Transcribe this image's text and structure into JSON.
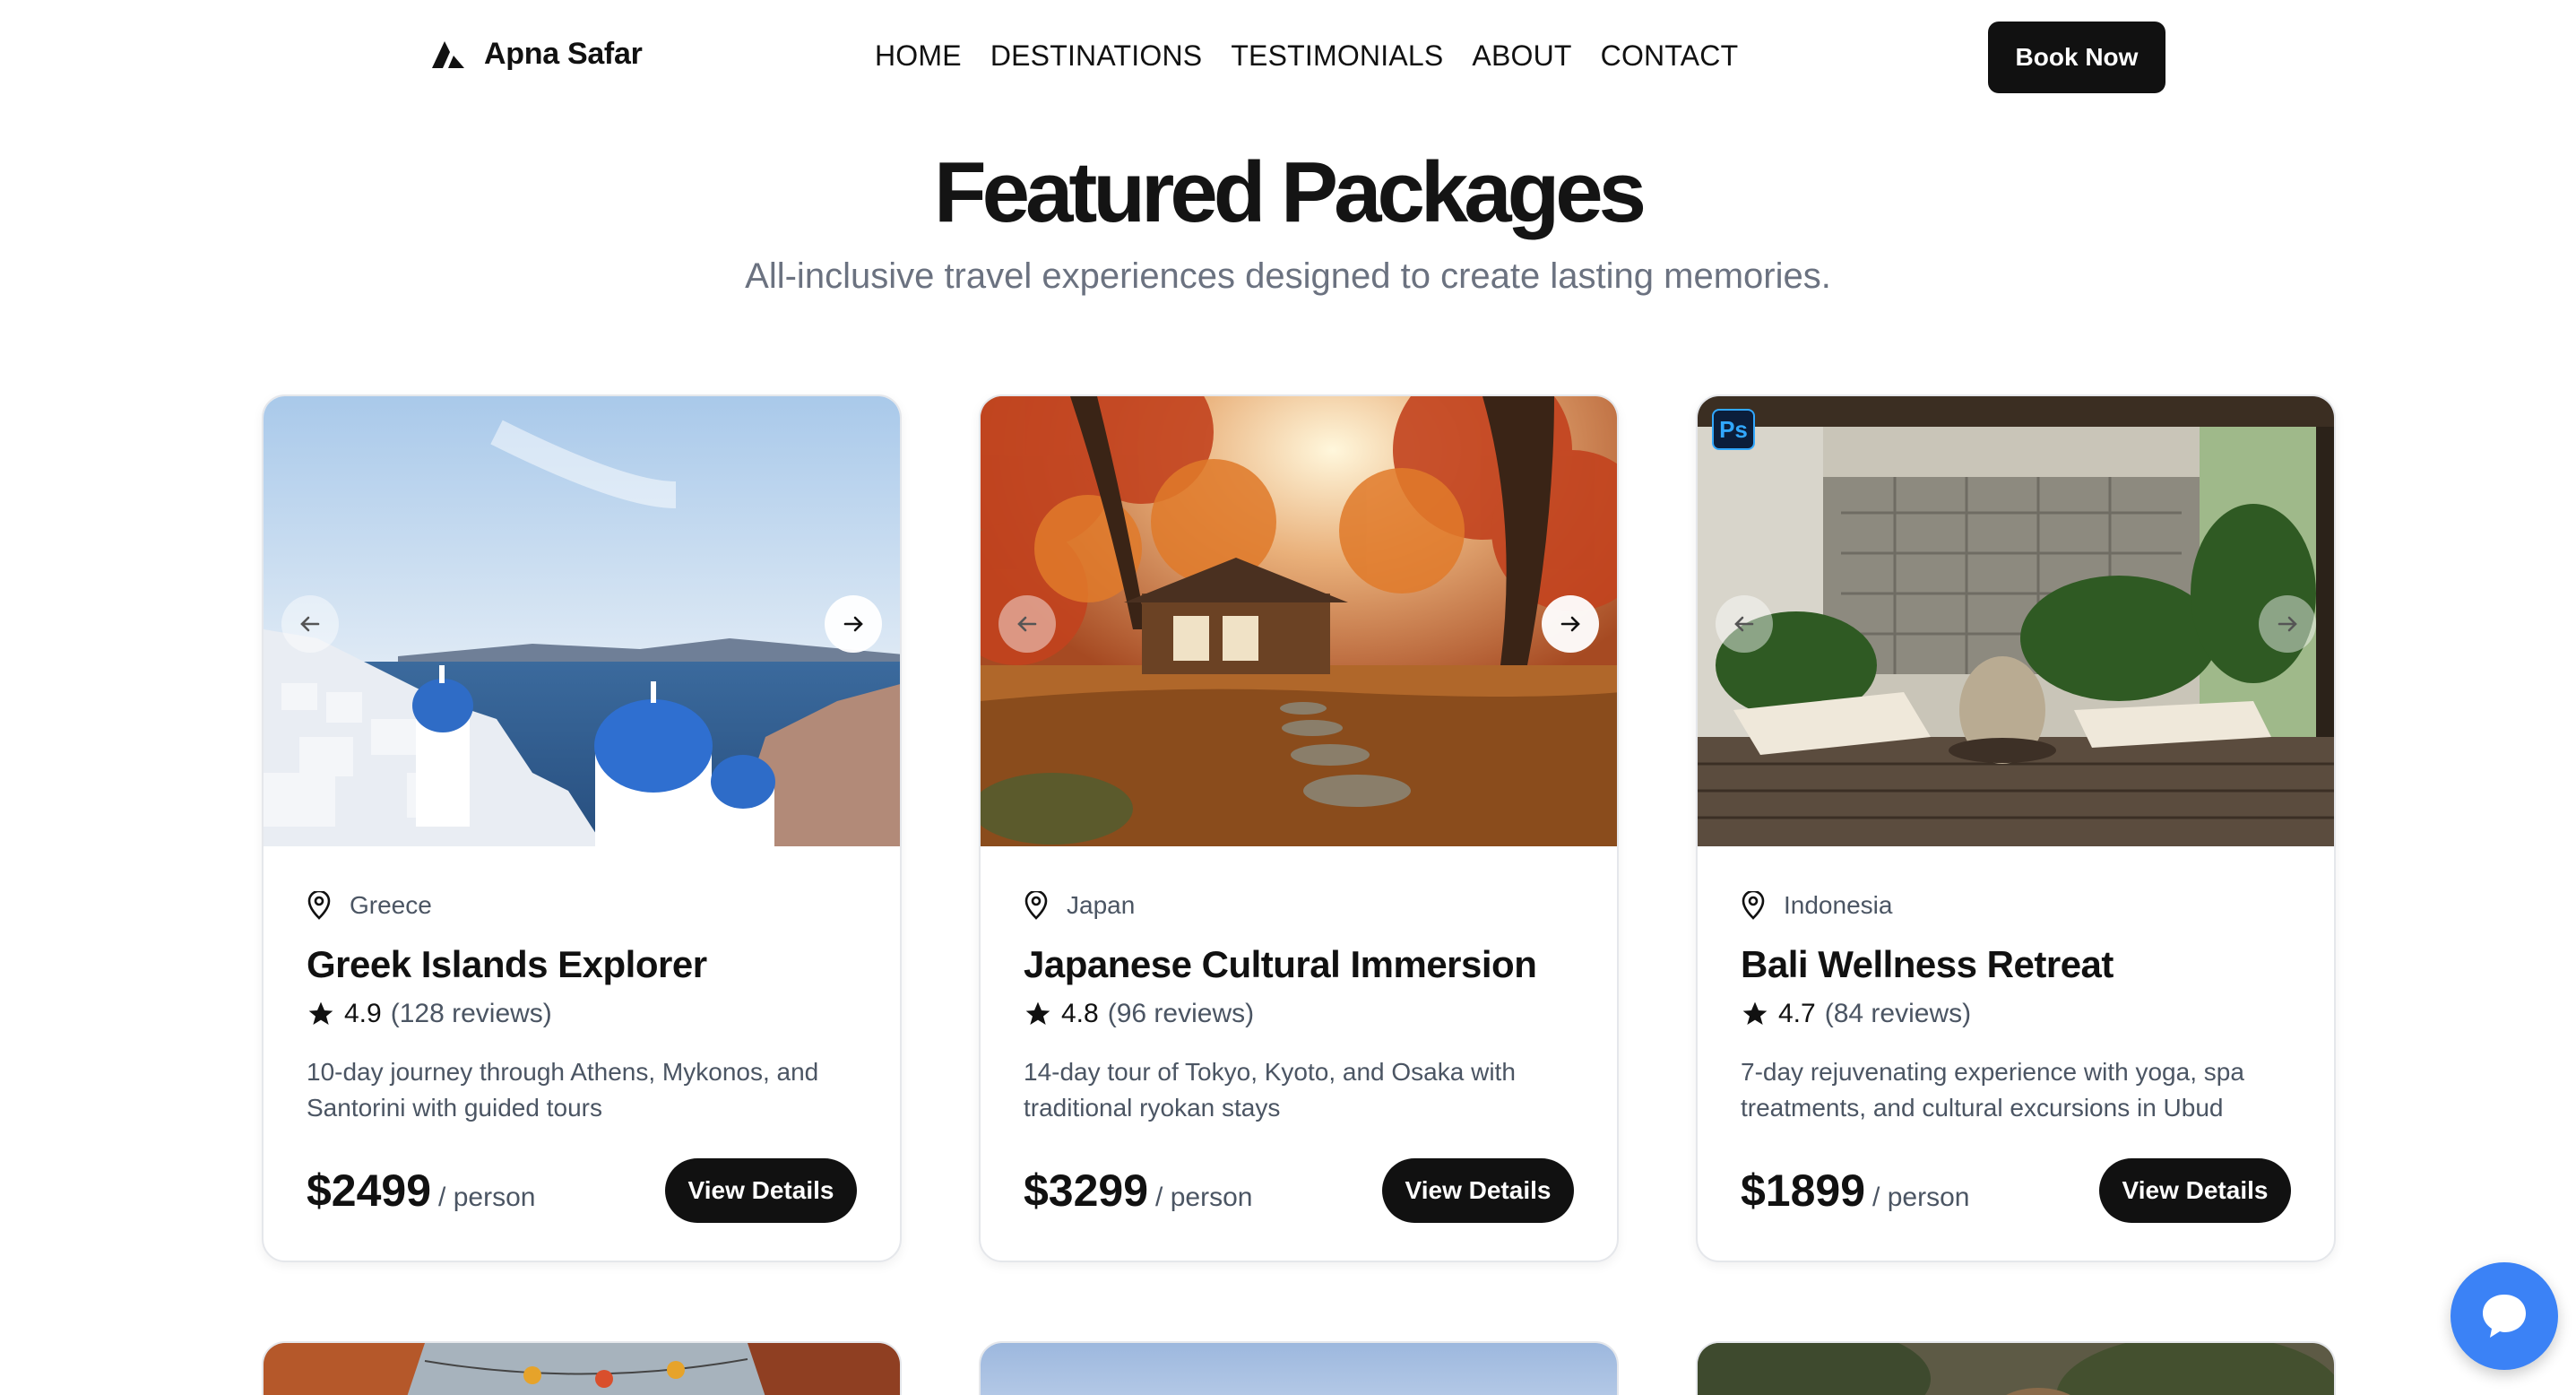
{
  "brand": {
    "name": "Apna Safar"
  },
  "nav": {
    "links": [
      "HOME",
      "DESTINATIONS",
      "TESTIMONIALS",
      "ABOUT",
      "CONTACT"
    ],
    "cta": "Book Now"
  },
  "hero": {
    "title": "Featured Packages",
    "subtitle": "All-inclusive travel experiences designed to create lasting memories."
  },
  "packages": [
    {
      "location": "Greece",
      "title": "Greek Islands Explorer",
      "rating": "4.9",
      "reviews": "(128 reviews)",
      "description": "10-day journey through Athens, Mykonos, and Santorini with guided tours",
      "price": "$2499",
      "per": "/ person",
      "cta": "View Details"
    },
    {
      "location": "Japan",
      "title": "Japanese Cultural Immersion",
      "rating": "4.8",
      "reviews": "(96 reviews)",
      "description": "14-day tour of Tokyo, Kyoto, and Osaka with traditional ryokan stays",
      "price": "$3299",
      "per": "/ person",
      "cta": "View Details"
    },
    {
      "location": "Indonesia",
      "title": "Bali Wellness Retreat",
      "rating": "4.7",
      "reviews": "(84 reviews)",
      "description": "7-day rejuvenating experience with yoga, spa treatments, and cultural excursions in Ubud",
      "price": "$1899",
      "per": "/ person",
      "cta": "View Details"
    }
  ],
  "badge": {
    "ps": "Ps"
  },
  "colors": {
    "accent": "#111111",
    "muted": "#6b7280",
    "chat": "#3b82f6"
  },
  "icons": {
    "location": "map-pin-icon",
    "star": "star-icon",
    "prev": "arrow-left-icon",
    "next": "arrow-right-icon",
    "chat": "chat-bubble-icon"
  }
}
